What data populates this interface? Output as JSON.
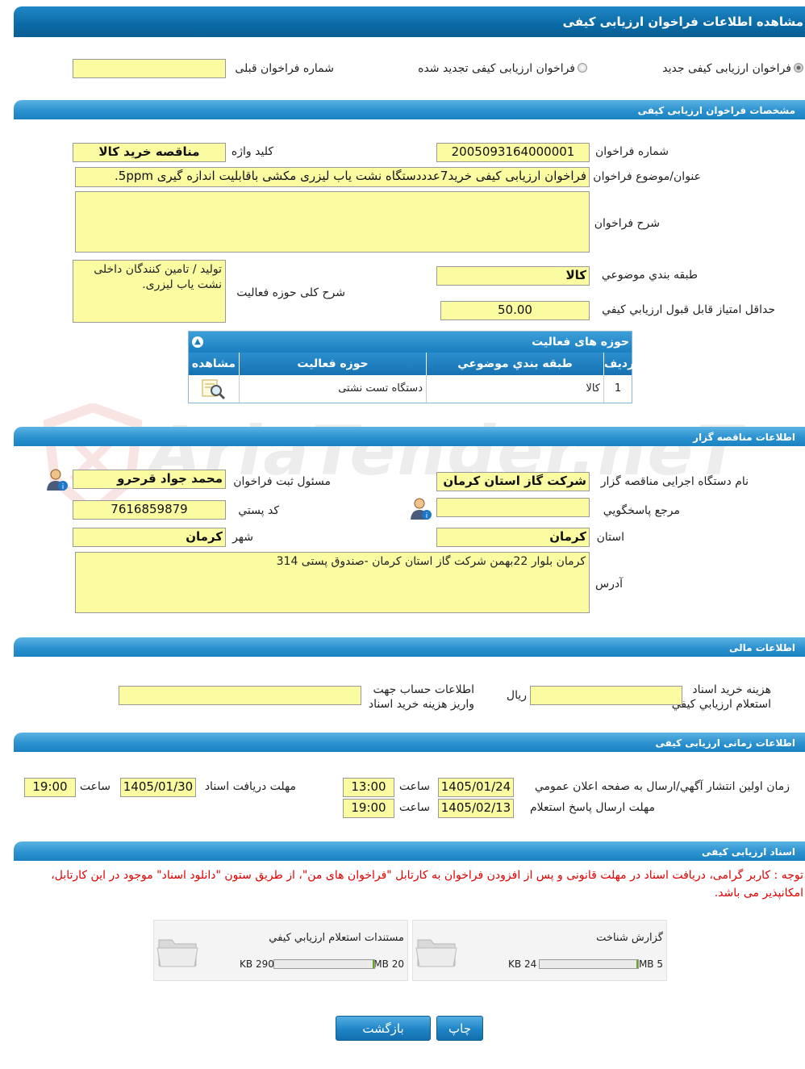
{
  "title": "مشاهده اطلاعات فراخوان ارزیابی کیفی",
  "type_row": {
    "new_label": "فراخوان ارزیابی کیفی جدید",
    "renewed_label": "فراخوان ارزیابی کیفی تجدید شده",
    "prev_number_label": "شماره فراخوان قبلی",
    "prev_number_value": ""
  },
  "sections": {
    "spec": "مشخصات فراخوان ارزیابی کیفی",
    "organizer": "اطلاعات مناقصه گزار",
    "finance": "اطلاعات مالی",
    "timing": "اطلاعات زمانی ارزیابی کیفی",
    "docs": "اسناد ارزیابی کیفی"
  },
  "spec": {
    "number_label": "شماره فراخوان",
    "number_value": "2005093164000001",
    "keyword_label": "کلید واژه",
    "keyword_value": "مناقصه خرید کالا",
    "subject_label": "عنوان/موضوع فراخوان",
    "subject_value": "فراخوان ارزیابی کیفی خرید7عدددستگاه نشت یاب لیزری مکشی باقابلیت اندازه گیری 5ppm.",
    "desc_label": "شرح فراخوان",
    "desc_value": "",
    "category_label": "طبقه بندي موضوعي",
    "category_value": "کالا",
    "activity_desc_label": "شرح کلی حوزه فعالیت",
    "activity_desc_value": "تولید / تامین کنندگان داخلی نشت یاب لیزری.",
    "min_score_label": "حداقل امتياز قابل قبول ارزيابي کيفي",
    "min_score_value": "50.00"
  },
  "activity_table": {
    "title": "حوزه های فعالیت",
    "columns": [
      "رديف",
      "طبقه بندي موضوعي",
      "حوزه فعاليت",
      "مشاهده"
    ],
    "rows": [
      {
        "index": "1",
        "category": "کالا",
        "activity": "دستگاه تست نشتی"
      }
    ]
  },
  "organizer": {
    "org_label": "نام دستگاه اجرایی مناقصه گزار",
    "org_value": "شرکت گاز استان کرمان",
    "responsible_label": "مسئول ثبت فراخوان",
    "responsible_value": "محمد جواد قرحرو",
    "responder_label": "مرجع پاسخگويي",
    "responder_value": "",
    "postal_label": "کد پستي",
    "postal_value": "7616859879",
    "province_label": "استان",
    "province_value": "کرمان",
    "city_label": "شهر",
    "city_value": "کرمان",
    "address_label": "آدرس",
    "address_value": "کرمان بلوار 22بهمن شرکت گاز استان کرمان -صندوق پستی 314"
  },
  "finance": {
    "doc_cost_label_1": "هزينه خريد اسناد",
    "doc_cost_label_2": "استعلام ارزيابي کيفي",
    "doc_cost_value": "",
    "currency": "ريال",
    "account_label_1": "اطلاعات حساب جهت",
    "account_label_2": "واریز هزینه خرید اسناد",
    "account_value": ""
  },
  "timing": {
    "publish_label": "زمان اولين انتشار آگهي/ارسال به صفحه اعلان عمومي",
    "publish_date": "1405/01/24",
    "publish_time": "13:00",
    "receive_label": "مهلت دریافت اسناد",
    "receive_date": "1405/01/30",
    "receive_time": "19:00",
    "reply_label": "مهلت ارسال پاسخ استعلام",
    "reply_date": "1405/02/13",
    "reply_time": "19:00",
    "time_label": "ساعت"
  },
  "docs": {
    "notice": "توجه : کاربر گرامی، دریافت اسناد در مهلت قانونی و پس از افزودن فراخوان به کارتابل \"فراخوان های من\"، از طریق ستون \"دانلود اسناد\" موجود در این کارتابل، امکانپذیر می باشد.",
    "files": [
      {
        "name": "گزارش شناخت",
        "size": "24 KB",
        "max": "5 MB",
        "fill": 0.005
      },
      {
        "name": "مستندات استعلام ارزيابي کيفي",
        "size": "290 KB",
        "max": "20 MB",
        "fill": 0.014
      }
    ]
  },
  "buttons": {
    "print": "چاپ",
    "back": "بازگشت"
  },
  "watermark": "AriaTender.neT"
}
